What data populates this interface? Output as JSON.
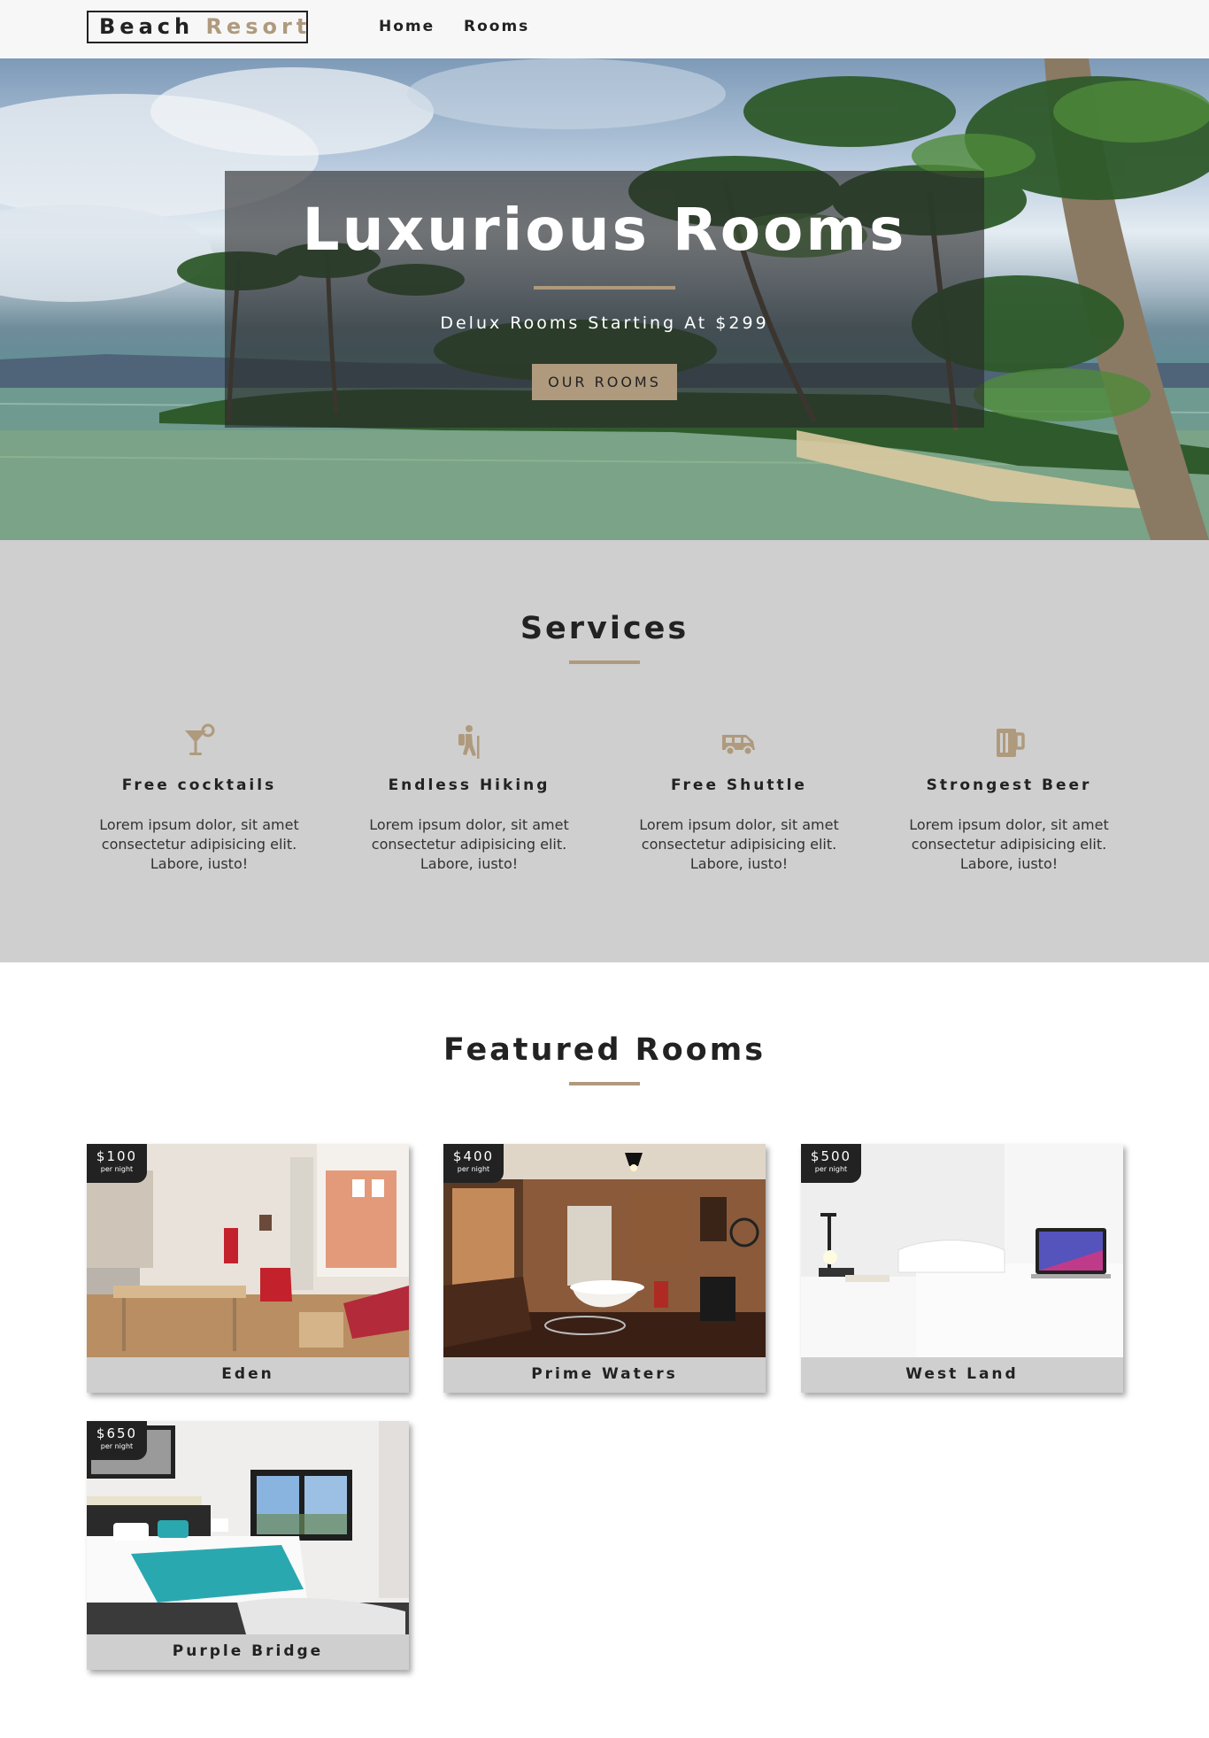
{
  "nav": {
    "logo_word1": "Beach",
    "logo_word2": "Resort",
    "links": [
      "Home",
      "Rooms"
    ]
  },
  "hero": {
    "title": "Luxurious Rooms",
    "subtitle": "Delux Rooms Starting At $299",
    "button": "OUR ROOMS"
  },
  "services": {
    "title": "Services",
    "items": [
      {
        "icon": "cocktail-icon",
        "title": "Free cocktails",
        "text": "Lorem ipsum dolor, sit amet consectetur adipisicing elit. Labore, iusto!"
      },
      {
        "icon": "hiking-icon",
        "title": "Endless Hiking",
        "text": "Lorem ipsum dolor, sit amet consectetur adipisicing elit. Labore, iusto!"
      },
      {
        "icon": "shuttle-van-icon",
        "title": "Free Shuttle",
        "text": "Lorem ipsum dolor, sit amet consectetur adipisicing elit. Labore, iusto!"
      },
      {
        "icon": "beer-icon",
        "title": "Strongest Beer",
        "text": "Lorem ipsum dolor, sit amet consectetur adipisicing elit. Labore, iusto!"
      }
    ]
  },
  "featured": {
    "title": "Featured Rooms",
    "rooms": [
      {
        "name": "Eden",
        "price": "$100",
        "unit": "per night"
      },
      {
        "name": "Prime Waters",
        "price": "$400",
        "unit": "per night"
      },
      {
        "name": "West Land",
        "price": "$500",
        "unit": "per night"
      },
      {
        "name": "Purple Bridge",
        "price": "$650",
        "unit": "per night"
      }
    ]
  },
  "colors": {
    "accent": "#af9a7d",
    "dark": "#222222",
    "services_bg": "#cfcfcf",
    "navbar_bg": "#f7f7f7"
  }
}
